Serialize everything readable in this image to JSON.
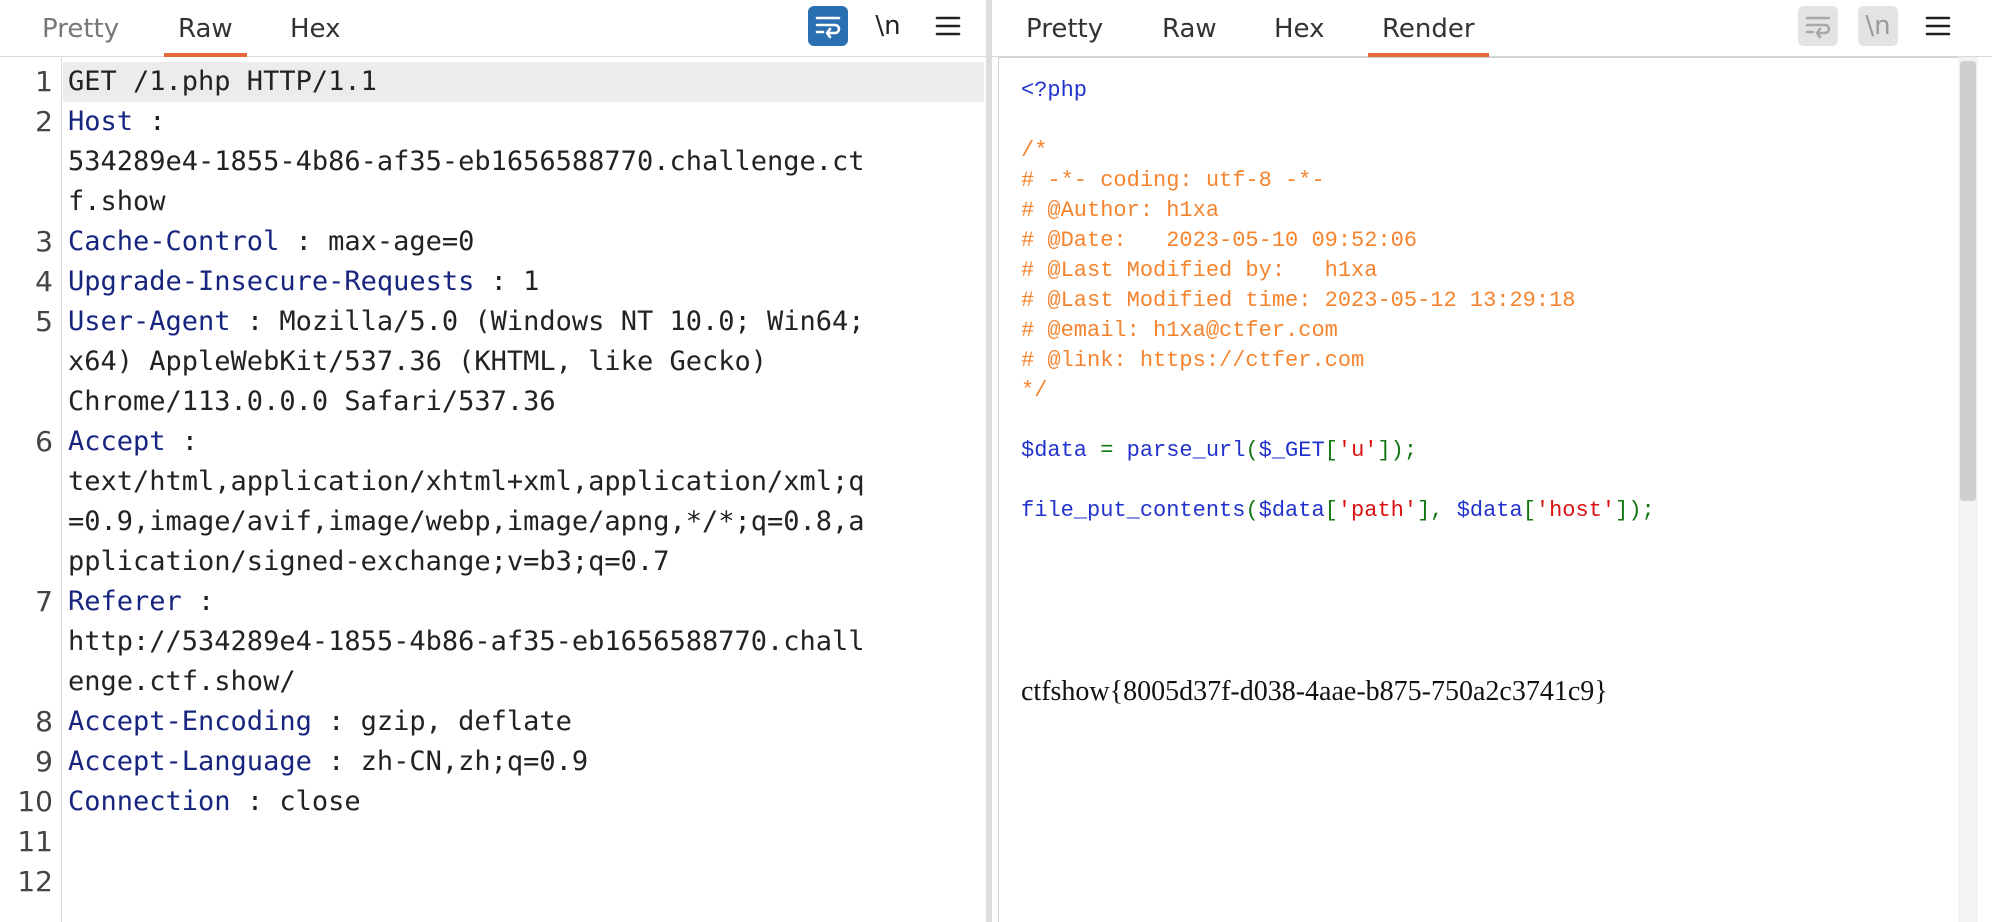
{
  "request": {
    "tabs": [
      {
        "label": "Pretty"
      },
      {
        "label": "Raw"
      },
      {
        "label": "Hex"
      }
    ],
    "active_tab": "Raw",
    "toolbar": {
      "wrap_icon": "wrap-lines-icon",
      "newline_label": "\\n",
      "menu_icon": "hamburger-menu-icon"
    },
    "line_numbers": [
      "1",
      "2",
      "3",
      "4",
      "5",
      "6",
      "7",
      "8",
      "9",
      "10",
      "11",
      "12"
    ],
    "lines": [
      {
        "name": "",
        "rest": "GET /1.php HTTP/1.1"
      },
      {
        "name": "Host",
        "rest": " :"
      },
      {
        "name": "",
        "rest": "534289e4-1855-4b86-af35-eb1656588770.challenge.ct"
      },
      {
        "name": "",
        "rest": "f.show"
      },
      {
        "name": "Cache-Control",
        "rest": " : max-age=0"
      },
      {
        "name": "Upgrade-Insecure-Requests",
        "rest": " : 1"
      },
      {
        "name": "User-Agent",
        "rest": " : Mozilla/5.0 (Windows NT 10.0; Win64;"
      },
      {
        "name": "",
        "rest": "x64) AppleWebKit/537.36 (KHTML, like Gecko)"
      },
      {
        "name": "",
        "rest": "Chrome/113.0.0.0 Safari/537.36"
      },
      {
        "name": "Accept",
        "rest": " :"
      },
      {
        "name": "",
        "rest": "text/html,application/xhtml+xml,application/xml;q"
      },
      {
        "name": "",
        "rest": "=0.9,image/avif,image/webp,image/apng,*/*;q=0.8,a"
      },
      {
        "name": "",
        "rest": "pplication/signed-exchange;v=b3;q=0.7"
      },
      {
        "name": "Referer",
        "rest": " :"
      },
      {
        "name": "",
        "rest": "http://534289e4-1855-4b86-af35-eb1656588770.chall"
      },
      {
        "name": "",
        "rest": "enge.ctf.show/"
      },
      {
        "name": "Accept-Encoding",
        "rest": " : gzip, deflate"
      },
      {
        "name": "Accept-Language",
        "rest": " : zh-CN,zh;q=0.9"
      },
      {
        "name": "Connection",
        "rest": " : close"
      },
      {
        "name": "",
        "rest": ""
      },
      {
        "name": "",
        "rest": ""
      }
    ]
  },
  "response": {
    "tabs": [
      {
        "label": "Pretty"
      },
      {
        "label": "Raw"
      },
      {
        "label": "Hex"
      },
      {
        "label": "Render"
      }
    ],
    "active_tab": "Render",
    "toolbar": {
      "wrap_icon": "wrap-lines-icon",
      "newline_label": "\\n",
      "menu_icon": "hamburger-menu-icon"
    },
    "render": {
      "php_open": "<?php",
      "comment_lines": [
        "/*",
        "# -*- coding: utf-8 -*-",
        "# @Author: h1xa",
        "# @Date:   2023-05-10 09:52:06",
        "# @Last Modified by:   h1xa",
        "# @Last Modified time: 2023-05-12 13:29:18",
        "# @email: h1xa@ctfer.com",
        "# @link: https://ctfer.com",
        "*/"
      ],
      "code_line_1": {
        "var": "$data",
        "op": " = ",
        "fn": "parse_url",
        "open": "(",
        "arg_var": "$_GET",
        "lb": "[",
        "key": "'u'",
        "close": "]);"
      },
      "code_line_2": {
        "fn": "file_put_contents",
        "open": "(",
        "var1": "$data",
        "lb1": "[",
        "key1": "'path'",
        "rb1": "], ",
        "var2": "$data",
        "lb2": "[",
        "key2": "'host'",
        "close": "]);"
      },
      "flag": "ctfshow{8005d37f-d038-4aae-b875-750a2c3741c9}"
    }
  },
  "colors": {
    "accent_tab": "#e8693a",
    "header_name": "#17257e",
    "comment": "#f5842f",
    "keyword": "#2233cc",
    "string": "#dd1111",
    "toggle_on": "#2a6fb1"
  }
}
